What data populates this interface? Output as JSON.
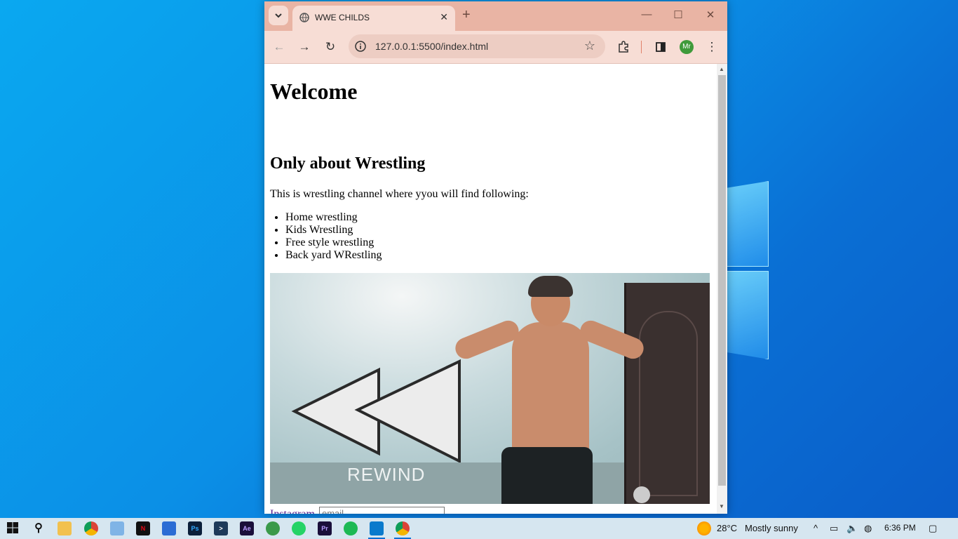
{
  "browser": {
    "tab_title": "WWE CHILDS",
    "url": "127.0.0.1:5500/index.html",
    "profile_initials": "Mr"
  },
  "page": {
    "heading": "Welcome",
    "subheading": "Only about Wrestling",
    "intro": "This is wrestling channel where yyou will find following:",
    "list_items": [
      "Home wrestling",
      "Kids Wrestling",
      "Free style wrestling",
      "Back yard WRestling"
    ],
    "image_overlay_text": "REWIND",
    "link_text": "Instagram",
    "email_placeholder": "email"
  },
  "taskbar": {
    "weather_temp": "28°C",
    "weather_desc": "Mostly sunny",
    "time": "6:36 PM",
    "apps": [
      "start-icon",
      "search-icon",
      "file-explorer-icon",
      "chrome-icon",
      "notepad-icon",
      "netflix-icon",
      "store-icon",
      "photoshop-icon",
      "terminal-icon",
      "after-effects-icon",
      "earth-icon",
      "whatsapp-icon",
      "premiere-icon",
      "spotify-icon",
      "vscode-icon",
      "chrome-active-icon"
    ]
  },
  "colors": {
    "tabbar": "#e9b4a4",
    "toolbar": "#f7ddd5",
    "link": "#551a8b"
  }
}
